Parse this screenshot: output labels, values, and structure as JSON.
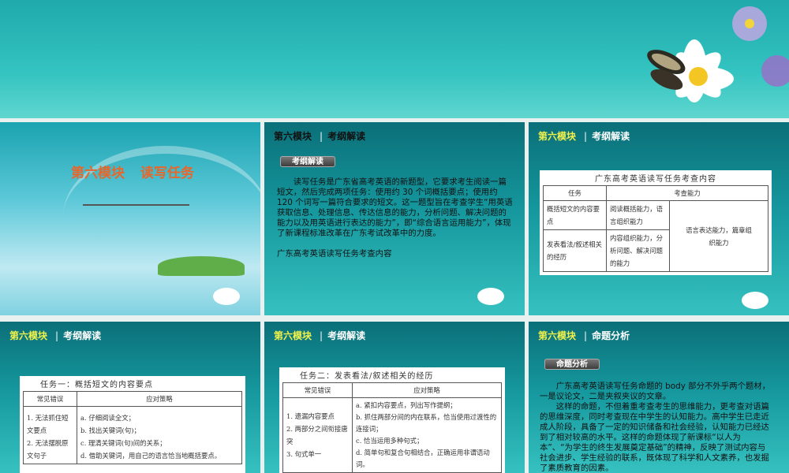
{
  "slides": [
    {
      "title_a": "第六模块",
      "title_b": "读写任务"
    },
    {
      "module": "第六模块",
      "section": "考纲解读",
      "pill": "考纲解读",
      "paragraph": "读写任务是广东省高考英语的新题型，它要求考生阅读一篇短文，然后完成两项任务：使用约 30 个词概括要点；使用约 120 个词写一篇符合要求的短文。这一题型旨在考查学生“用英语获取信息、处理信息、传达信息的能力，分析问题、解决问题的能力以及用英语进行表达的能力”，即“综合语言运用能力”，体现了新课程标准改革在广东考试改革中的力度。",
      "trailing": "广东高考英语读写任务考查内容"
    },
    {
      "module": "第六模块",
      "section": "考纲解读",
      "table_caption": "广东高考英语读写任务考查内容",
      "headers": [
        "任务",
        "考查能力"
      ],
      "rows": [
        {
          "task": "概括短文的内容要点",
          "ability": "阅读概括能力，语言组织能力"
        },
        {
          "task": "发表看法/叙述相关的经历",
          "ability": "内容组织能力，分析问题、解决问题的能力"
        }
      ],
      "shared_ability": "语言表达能力，篇章组织能力"
    },
    {
      "module": "第六模块",
      "section": "考纲解读",
      "table_caption": "任务一：概括短文的内容要点",
      "headers": [
        "常见错误",
        "应对策略"
      ],
      "errors": [
        "1. 无法抓住短文要点",
        "2. 无法摆脱原文句子"
      ],
      "strategies": [
        "a. 仔细阅读全文；",
        "b. 找出关键词(句)；",
        "c. 理清关键词(句)间的关系；",
        "d. 借助关键词，用自己的语言恰当地概括要点。"
      ]
    },
    {
      "module": "第六模块",
      "section": "考纲解读",
      "table_caption": "任务二：发表看法/叙述相关的经历",
      "headers": [
        "常见错误",
        "应对策略"
      ],
      "errors": [
        "1. 遗漏内容要点",
        "2. 两部分之间衔接唐突",
        "3. 句式单一"
      ],
      "strategies": [
        "a. 紧扣内容要点，列出写作提纲；",
        "b. 抓住两部分间的内在联系，恰当使用过渡性的连接词；",
        "c. 恰当运用多种句式；",
        "d. 简单句和复合句相结合，正确运用非谓语动词。"
      ]
    },
    {
      "module": "第六模块",
      "section": "命题分析",
      "pill": "命题分析",
      "paragraph1": "广东高考英语读写任务命题的 body 部分不外乎两个题材，一是议论文，二是夹叙夹议的文章。",
      "paragraph2": "这样的命题，不但着重考查考生的思维能力，更考查对语篇的思维深度，同时考查现在中学生的认知能力。高中学生已走近成人阶段，具备了一定的知识储备和社会经验，认知能力已经达到了相对较高的水平。这样的命题体现了新课标“以人为本”、“为学生的终生发展奠定基础”的精神，反映了测试内容与社会进步、学生经验的联系，既体现了科学和人文素养，也发掘了素质教育的因素。"
    }
  ]
}
